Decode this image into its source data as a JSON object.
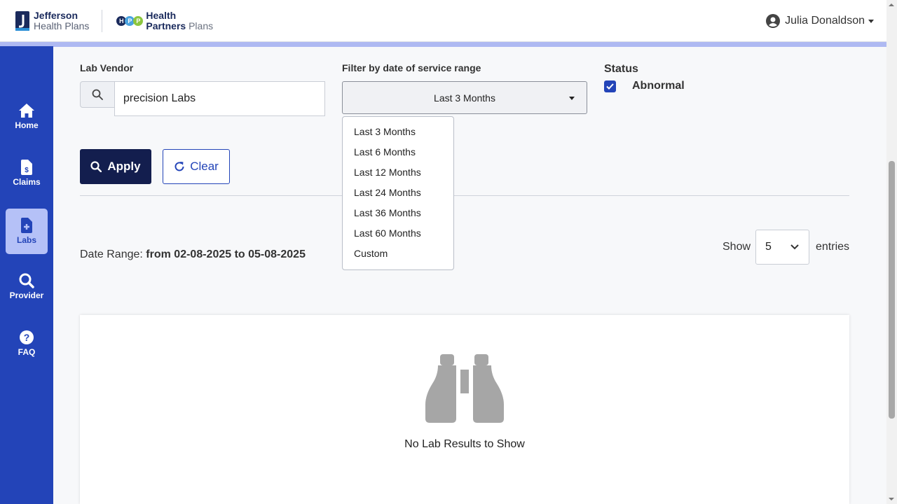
{
  "header": {
    "brand1": {
      "line1": "Jefferson",
      "line2": "Health Plans"
    },
    "brand2": {
      "dots": [
        "H",
        "P",
        "P"
      ],
      "line1": "Health",
      "line2a": "Partners",
      "line2b": "Plans"
    },
    "user_name": "Julia Donaldson"
  },
  "sidebar": {
    "items": [
      {
        "label": "Home",
        "icon": "home-icon"
      },
      {
        "label": "Claims",
        "icon": "claims-icon"
      },
      {
        "label": "Labs",
        "icon": "labs-icon",
        "active": true
      },
      {
        "label": "Provider",
        "icon": "search-icon"
      },
      {
        "label": "FAQ",
        "icon": "question-icon"
      }
    ]
  },
  "filters": {
    "vendor_label": "Lab Vendor",
    "vendor_value": "precision Labs",
    "range_label": "Filter by date of service range",
    "range_selected": "Last 3 Months",
    "range_options": [
      "Last 3 Months",
      "Last 6 Months",
      "Last 12 Months",
      "Last 24 Months",
      "Last 36 Months",
      "Last 60 Months",
      "Custom"
    ],
    "status_label": "Status",
    "abnormal_label": "Abnormal",
    "abnormal_checked": true
  },
  "actions": {
    "apply": "Apply",
    "clear": "Clear"
  },
  "summary": {
    "date_range_prefix": "Date Range:",
    "date_range_value": "from 02-08-2025 to 05-08-2025",
    "show_label": "Show",
    "entries_value": "5",
    "entries_label": "entries"
  },
  "results": {
    "empty_message": "No Lab Results to Show"
  },
  "colors": {
    "primary": "#2344b8",
    "dark": "#131e4e",
    "active_nav": "#b5c1f7",
    "accent_bar": "#aeb9f2"
  }
}
